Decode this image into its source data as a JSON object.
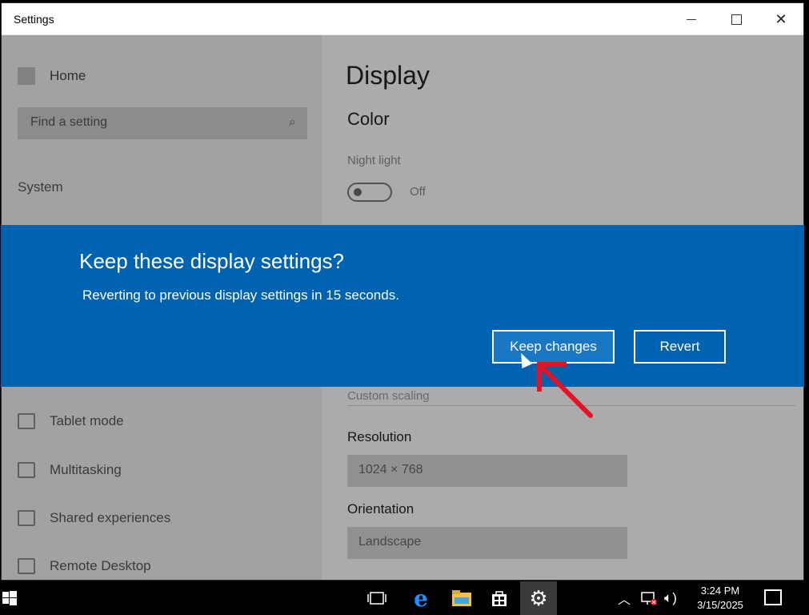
{
  "window": {
    "title": "Settings",
    "close_glyph": "✕"
  },
  "sidebar": {
    "home_label": "Home",
    "search_placeholder": "Find a setting",
    "section_label": "System",
    "items": [
      {
        "label": "Tablet mode",
        "icon": "tablet-mode-icon"
      },
      {
        "label": "Multitasking",
        "icon": "multitasking-icon"
      },
      {
        "label": "Shared experiences",
        "icon": "shared-experiences-icon"
      },
      {
        "label": "Remote Desktop",
        "icon": "remote-desktop-icon"
      }
    ]
  },
  "main": {
    "page_title": "Display",
    "color_heading": "Color",
    "night_light_label": "Night light",
    "night_light_state": "Off",
    "custom_scaling_label": "Custom scaling",
    "resolution_label": "Resolution",
    "resolution_value": "1024 × 768",
    "orientation_label": "Orientation",
    "orientation_value": "Landscape"
  },
  "dialog": {
    "title": "Keep these display settings?",
    "message": "Reverting to previous display settings in 15 seconds.",
    "keep_label": "Keep changes",
    "revert_label": "Revert",
    "accent_color": "#0063b1"
  },
  "annotation": {
    "arrow_color": "#e81123"
  },
  "taskbar": {
    "time": "3:24 PM",
    "date": "3/15/2025",
    "pinned": [
      "task-view-icon",
      "edge-icon",
      "file-explorer-icon",
      "store-icon",
      "settings-icon"
    ]
  }
}
